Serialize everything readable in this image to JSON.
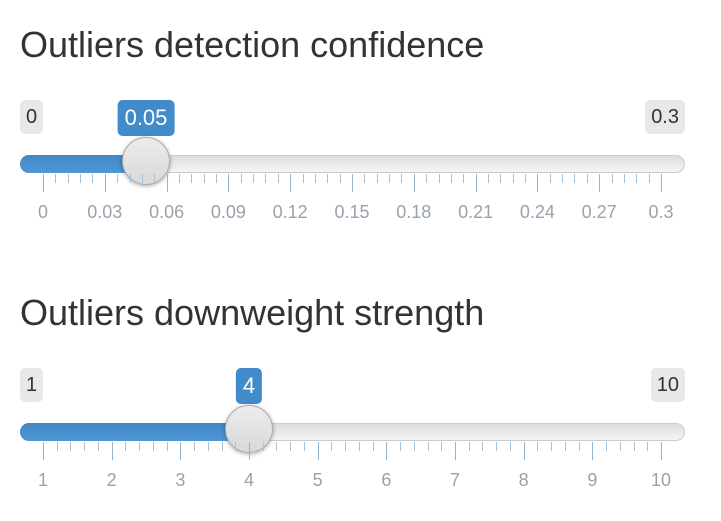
{
  "sliders": [
    {
      "title": "Outliers detection confidence",
      "min_label": "0",
      "max_label": "0.3",
      "current_label": "0.05",
      "min": 0,
      "max": 0.3,
      "value": 0.05,
      "ticks": [
        "0",
        "0.03",
        "0.06",
        "0.09",
        "0.12",
        "0.15",
        "0.18",
        "0.21",
        "0.24",
        "0.27",
        "0.3"
      ],
      "minor_per_major": 5
    },
    {
      "title": "Outliers downweight strength",
      "min_label": "1",
      "max_label": "10",
      "current_label": "4",
      "min": 1,
      "max": 10,
      "value": 4,
      "ticks": [
        "1",
        "2",
        "3",
        "4",
        "5",
        "6",
        "7",
        "8",
        "9",
        "10"
      ],
      "minor_per_major": 5
    }
  ],
  "colors": {
    "accent": "#428bca",
    "track": "#eeeeee",
    "tick_label": "#99a3ad",
    "title": "#333333"
  }
}
